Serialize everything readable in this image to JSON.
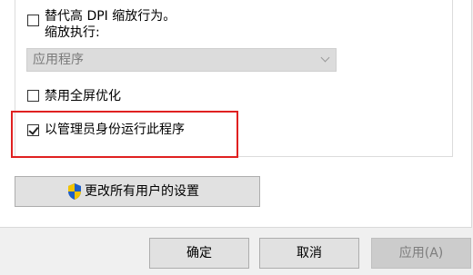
{
  "settings": {
    "dpi_override_label": "替代高 DPI 缩放行为。",
    "scaling_performed_by_label": "缩放执行:",
    "scaling_dropdown_value": "应用程序",
    "disable_fullscreen_opt_label": "禁用全屏优化",
    "run_as_admin_label": "以管理员身份运行此程序",
    "run_as_admin_checked": true
  },
  "change_all_users_label": "更改所有用户的设置",
  "buttons": {
    "ok": "确定",
    "cancel": "取消",
    "apply": "应用(A)"
  },
  "colors": {
    "highlight": "#e02020",
    "shield_blue": "#1e5fc8",
    "shield_yellow": "#f2c400"
  }
}
